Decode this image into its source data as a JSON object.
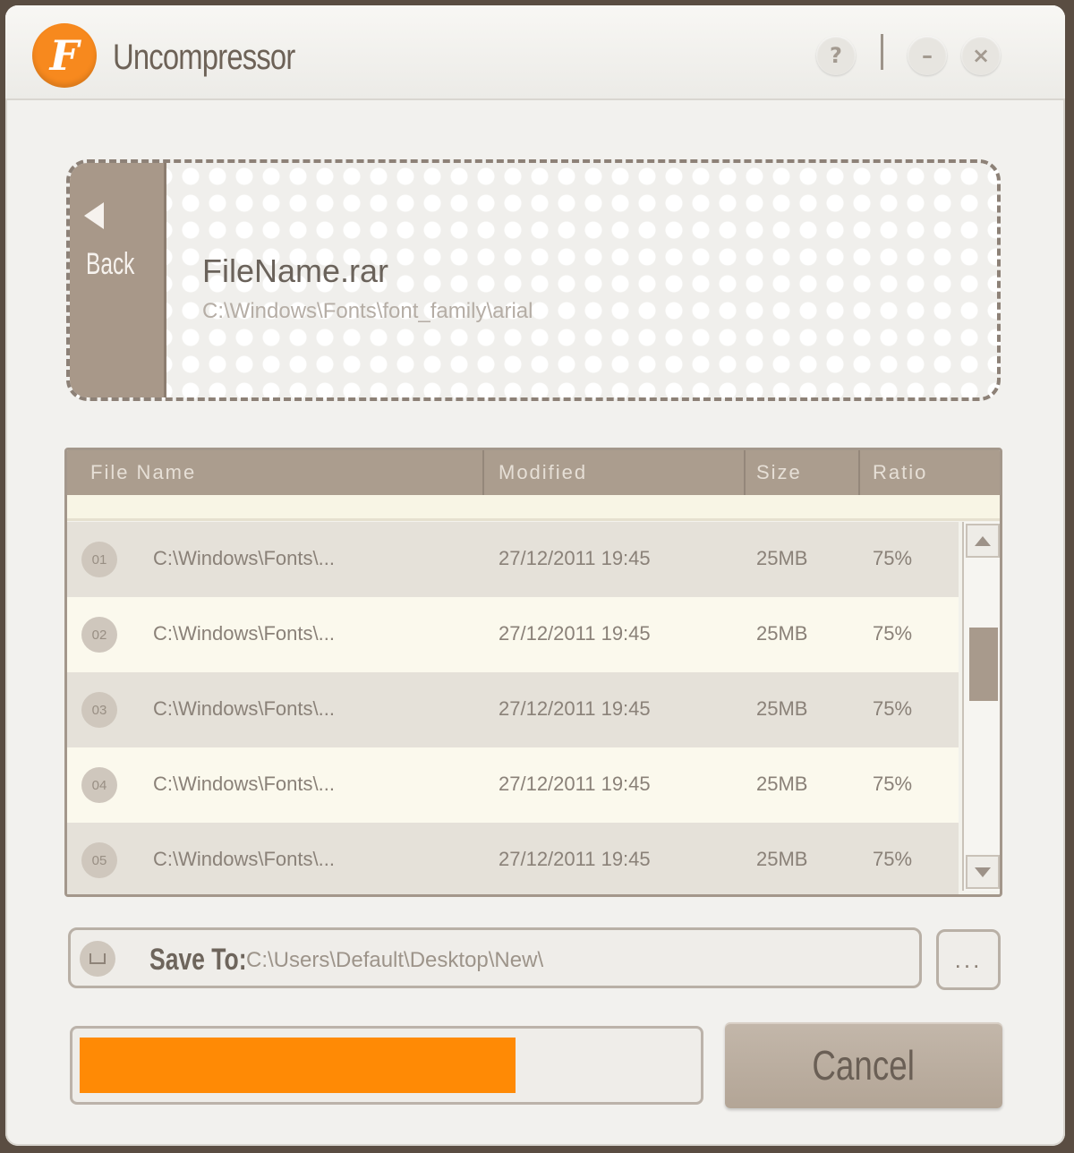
{
  "app": {
    "title": "Uncompressor",
    "logo_letter": "F",
    "accent_color": "#f7891e"
  },
  "titlebar": {
    "help_glyph": "?",
    "minimize_glyph": "–",
    "close_glyph": "×"
  },
  "archive": {
    "back_label": "Back",
    "name": "FileName.rar",
    "path": "C:\\Windows\\Fonts\\font_family\\arial"
  },
  "table": {
    "columns": [
      "File Name",
      "Modified",
      "Size",
      "Ratio"
    ],
    "rows": [
      {
        "num": "01",
        "file": "C:\\Windows\\Fonts\\...",
        "modified": "27/12/2011  19:45",
        "size": "25MB",
        "ratio": "75%"
      },
      {
        "num": "02",
        "file": "C:\\Windows\\Fonts\\...",
        "modified": "27/12/2011  19:45",
        "size": "25MB",
        "ratio": "75%"
      },
      {
        "num": "03",
        "file": "C:\\Windows\\Fonts\\...",
        "modified": "27/12/2011  19:45",
        "size": "25MB",
        "ratio": "75%"
      },
      {
        "num": "04",
        "file": "C:\\Windows\\Fonts\\...",
        "modified": "27/12/2011  19:45",
        "size": "25MB",
        "ratio": "75%"
      },
      {
        "num": "05",
        "file": "C:\\Windows\\Fonts\\...",
        "modified": "27/12/2011  19:45",
        "size": "25MB",
        "ratio": "75%"
      }
    ]
  },
  "save": {
    "label": "Save To:",
    "path": "C:\\Users\\Default\\Desktop\\New\\",
    "browse_label": "..."
  },
  "progress": {
    "fraction": 0.71,
    "color": "#ff8a05"
  },
  "cancel_label": "Cancel"
}
